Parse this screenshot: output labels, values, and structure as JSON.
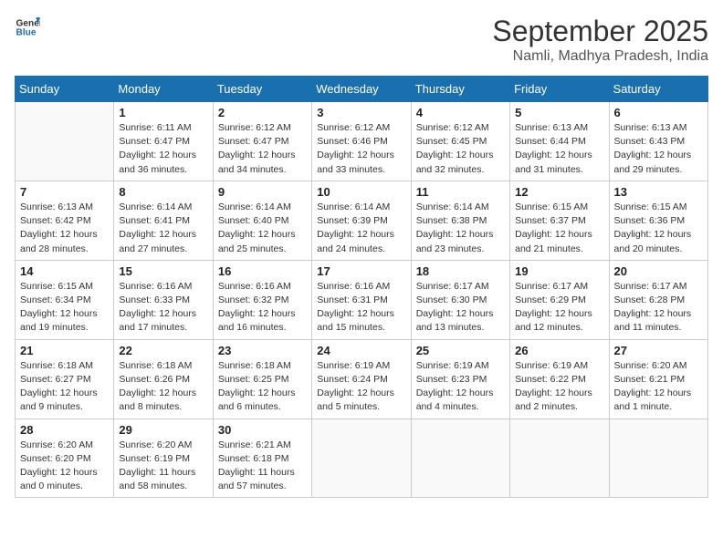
{
  "logo": {
    "line1": "General",
    "line2": "Blue"
  },
  "title": "September 2025",
  "location": "Namli, Madhya Pradesh, India",
  "weekdays": [
    "Sunday",
    "Monday",
    "Tuesday",
    "Wednesday",
    "Thursday",
    "Friday",
    "Saturday"
  ],
  "weeks": [
    [
      {
        "day": "",
        "info": ""
      },
      {
        "day": "1",
        "info": "Sunrise: 6:11 AM\nSunset: 6:47 PM\nDaylight: 12 hours\nand 36 minutes."
      },
      {
        "day": "2",
        "info": "Sunrise: 6:12 AM\nSunset: 6:47 PM\nDaylight: 12 hours\nand 34 minutes."
      },
      {
        "day": "3",
        "info": "Sunrise: 6:12 AM\nSunset: 6:46 PM\nDaylight: 12 hours\nand 33 minutes."
      },
      {
        "day": "4",
        "info": "Sunrise: 6:12 AM\nSunset: 6:45 PM\nDaylight: 12 hours\nand 32 minutes."
      },
      {
        "day": "5",
        "info": "Sunrise: 6:13 AM\nSunset: 6:44 PM\nDaylight: 12 hours\nand 31 minutes."
      },
      {
        "day": "6",
        "info": "Sunrise: 6:13 AM\nSunset: 6:43 PM\nDaylight: 12 hours\nand 29 minutes."
      }
    ],
    [
      {
        "day": "7",
        "info": "Sunrise: 6:13 AM\nSunset: 6:42 PM\nDaylight: 12 hours\nand 28 minutes."
      },
      {
        "day": "8",
        "info": "Sunrise: 6:14 AM\nSunset: 6:41 PM\nDaylight: 12 hours\nand 27 minutes."
      },
      {
        "day": "9",
        "info": "Sunrise: 6:14 AM\nSunset: 6:40 PM\nDaylight: 12 hours\nand 25 minutes."
      },
      {
        "day": "10",
        "info": "Sunrise: 6:14 AM\nSunset: 6:39 PM\nDaylight: 12 hours\nand 24 minutes."
      },
      {
        "day": "11",
        "info": "Sunrise: 6:14 AM\nSunset: 6:38 PM\nDaylight: 12 hours\nand 23 minutes."
      },
      {
        "day": "12",
        "info": "Sunrise: 6:15 AM\nSunset: 6:37 PM\nDaylight: 12 hours\nand 21 minutes."
      },
      {
        "day": "13",
        "info": "Sunrise: 6:15 AM\nSunset: 6:36 PM\nDaylight: 12 hours\nand 20 minutes."
      }
    ],
    [
      {
        "day": "14",
        "info": "Sunrise: 6:15 AM\nSunset: 6:34 PM\nDaylight: 12 hours\nand 19 minutes."
      },
      {
        "day": "15",
        "info": "Sunrise: 6:16 AM\nSunset: 6:33 PM\nDaylight: 12 hours\nand 17 minutes."
      },
      {
        "day": "16",
        "info": "Sunrise: 6:16 AM\nSunset: 6:32 PM\nDaylight: 12 hours\nand 16 minutes."
      },
      {
        "day": "17",
        "info": "Sunrise: 6:16 AM\nSunset: 6:31 PM\nDaylight: 12 hours\nand 15 minutes."
      },
      {
        "day": "18",
        "info": "Sunrise: 6:17 AM\nSunset: 6:30 PM\nDaylight: 12 hours\nand 13 minutes."
      },
      {
        "day": "19",
        "info": "Sunrise: 6:17 AM\nSunset: 6:29 PM\nDaylight: 12 hours\nand 12 minutes."
      },
      {
        "day": "20",
        "info": "Sunrise: 6:17 AM\nSunset: 6:28 PM\nDaylight: 12 hours\nand 11 minutes."
      }
    ],
    [
      {
        "day": "21",
        "info": "Sunrise: 6:18 AM\nSunset: 6:27 PM\nDaylight: 12 hours\nand 9 minutes."
      },
      {
        "day": "22",
        "info": "Sunrise: 6:18 AM\nSunset: 6:26 PM\nDaylight: 12 hours\nand 8 minutes."
      },
      {
        "day": "23",
        "info": "Sunrise: 6:18 AM\nSunset: 6:25 PM\nDaylight: 12 hours\nand 6 minutes."
      },
      {
        "day": "24",
        "info": "Sunrise: 6:19 AM\nSunset: 6:24 PM\nDaylight: 12 hours\nand 5 minutes."
      },
      {
        "day": "25",
        "info": "Sunrise: 6:19 AM\nSunset: 6:23 PM\nDaylight: 12 hours\nand 4 minutes."
      },
      {
        "day": "26",
        "info": "Sunrise: 6:19 AM\nSunset: 6:22 PM\nDaylight: 12 hours\nand 2 minutes."
      },
      {
        "day": "27",
        "info": "Sunrise: 6:20 AM\nSunset: 6:21 PM\nDaylight: 12 hours\nand 1 minute."
      }
    ],
    [
      {
        "day": "28",
        "info": "Sunrise: 6:20 AM\nSunset: 6:20 PM\nDaylight: 12 hours\nand 0 minutes."
      },
      {
        "day": "29",
        "info": "Sunrise: 6:20 AM\nSunset: 6:19 PM\nDaylight: 11 hours\nand 58 minutes."
      },
      {
        "day": "30",
        "info": "Sunrise: 6:21 AM\nSunset: 6:18 PM\nDaylight: 11 hours\nand 57 minutes."
      },
      {
        "day": "",
        "info": ""
      },
      {
        "day": "",
        "info": ""
      },
      {
        "day": "",
        "info": ""
      },
      {
        "day": "",
        "info": ""
      }
    ]
  ]
}
